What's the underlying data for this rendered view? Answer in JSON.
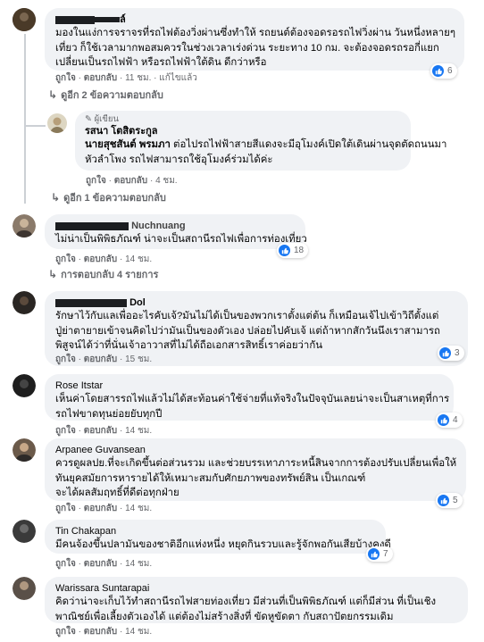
{
  "comments": [
    {
      "id": "c1",
      "author_suffix": "ล์",
      "lines": [
        "มองในแง่การจราจรที่รถไฟต้องวิ่งผ่านซึ่งทำให้ รถยนต์ต้องจอดรอรถไฟวิ่งผ่าน วันหนึ่งหลายๆ",
        "เที่ยว ก็ใช้เวลามากพอสมควรในช่วงเวลาเร่งด่วน ระยะทาง 10 กม. จะต้องจอดรถรอกี่แยก",
        "เปลี่ยนเป็นรถไฟฟ้า หรือรถไฟฟ้าใต้ดิน ดีกว่าหรือ"
      ],
      "like": "ถูกใจ",
      "reply": "ตอบกลับ",
      "time": "11 ชม.",
      "edited": "แก้ไขแล้ว",
      "reactions": "6"
    },
    {
      "id": "c1r",
      "author_badge": "ผู้เขียน",
      "author": "รสนา โตสิตระกูล",
      "lines_bold": "นายสุชสันต์ พรมภา",
      "lines": [
        " ต่อไปรถไฟฟ้าสายสีแดงจะมีอุโมงค์เปิดใต้เดินผ่านจุดตัดถนนมา",
        "หัวลำโพง รถไฟสามารถใช้อุโมงค์ร่วมได้ค่ะ"
      ],
      "like": "ถูกใจ",
      "reply": "ตอบกลับ",
      "time": "4 ชม."
    },
    {
      "id": "c2",
      "author_suffix": "Nuchnuang",
      "lines": [
        "ไม่น่าเป็นพิพิธภัณฑ์ น่าจะเป็นสถานีรถไฟเพื่อการท่องเที่ยว"
      ],
      "like": "ถูกใจ",
      "reply": "ตอบกลับ",
      "time": "14 ชม.",
      "reactions": "18"
    },
    {
      "id": "c3",
      "author_suffix": "Dol",
      "lines": [
        "รักษาไว้กับแลเพื่ออะไรคับเจ้?มันไม่ได้เป็นของพวกเราตั้งแต่ต้น ก็เหมือนเจ้ไปเข้าวิถีตั้งแต่",
        "ปู่ย่าตายายเข้าจนคิดไปว่ามันเป็นของตัวเอง ปล่อยไปคับเจ้ แต่ถ้าหากสักวันนึงเราสามารถ",
        "พิสูจน์ได้ว่าที่นั่นเจ้าอาวาสที่ไม่ได้ถือเอกสารสิทธิ์เราค่อยว่ากัน"
      ],
      "like": "ถูกใจ",
      "reply": "ตอบกลับ",
      "time": "15 ชม.",
      "reactions": "3"
    },
    {
      "id": "c4",
      "author": "Rose Itstar",
      "lines": [
        "เห็นค่าโดยสารรถไฟแล้วไม่ได้สะท้อนค่าใช้จ่ายที่แท้จริงในปัจจุบันเลยน่าจะเป็นสาเหตุที่การ",
        "รถไฟขาดทุนย่อยยับทุกปี"
      ],
      "like": "ถูกใจ",
      "reply": "ตอบกลับ",
      "time": "14 ชม.",
      "reactions": "4"
    },
    {
      "id": "c5",
      "author": "Arpanee Guvansean",
      "lines": [
        "ควรดูผลปย.ที่จะเกิดขึ้นต่อส่วนรวม และช่วยบรรเทาภาระหนี้สินจากการต้องปรับเปลี่ยนเพื่อให้",
        "ทันยุคสมัยการหารายได้ให้เหมาะสมกับศักยภาพของทรัพย์สิน เป็นเกณฑ์",
        "จะได้ผลสัมฤทธิ์ที่ดีต่อทุกฝ่าย"
      ],
      "like": "ถูกใจ",
      "reply": "ตอบกลับ",
      "time": "14 ชม.",
      "reactions": "5"
    },
    {
      "id": "c6",
      "author": "Tin Chakapan",
      "lines": [
        "มีคนจ้องขึ้นปลามันของชาติอีกแห่งหนึ่ง หยุดกินรวบและรู้จักพอกันเสียบ้างคงดี"
      ],
      "like": "ถูกใจ",
      "reply": "ตอบกลับ",
      "time": "14 ชม.",
      "reactions": "7"
    },
    {
      "id": "c7",
      "author": "Warissara Suntarapai",
      "lines": [
        "คิดว่าน่าจะเก็บไว้ทำสถานีรถไฟสายท่องเที่ยว มีส่วนที่เป็นพิพิธภัณฑ์ แต่ก็มีส่วน ที่เป็นเชิง",
        "พาณิชย์เพื่อเลี้ยงตัวเองได้ แต่ต้องไม่สร้างสิ่งที่ ขัดหูขัดตา กับสถาปัตยกรรมเดิม"
      ],
      "like": "ถูกใจ",
      "reply": "ตอบกลับ",
      "time": "14 ชม."
    }
  ],
  "replies_links": {
    "c1_more": "ดูอีก 2 ข้อความตอบกลับ",
    "c1r_more": "ดูอีก 1 ข้อความตอบกลับ",
    "c2_more": "การตอบกลับ 4 รายการ"
  },
  "separator": "·",
  "colors": {
    "bubble": "#f0f2f5",
    "meta": "#65676b",
    "like_blue": "#1877f2"
  },
  "icons": {
    "like": "thumbs-up-icon",
    "reply": "reply-arrow-icon"
  }
}
